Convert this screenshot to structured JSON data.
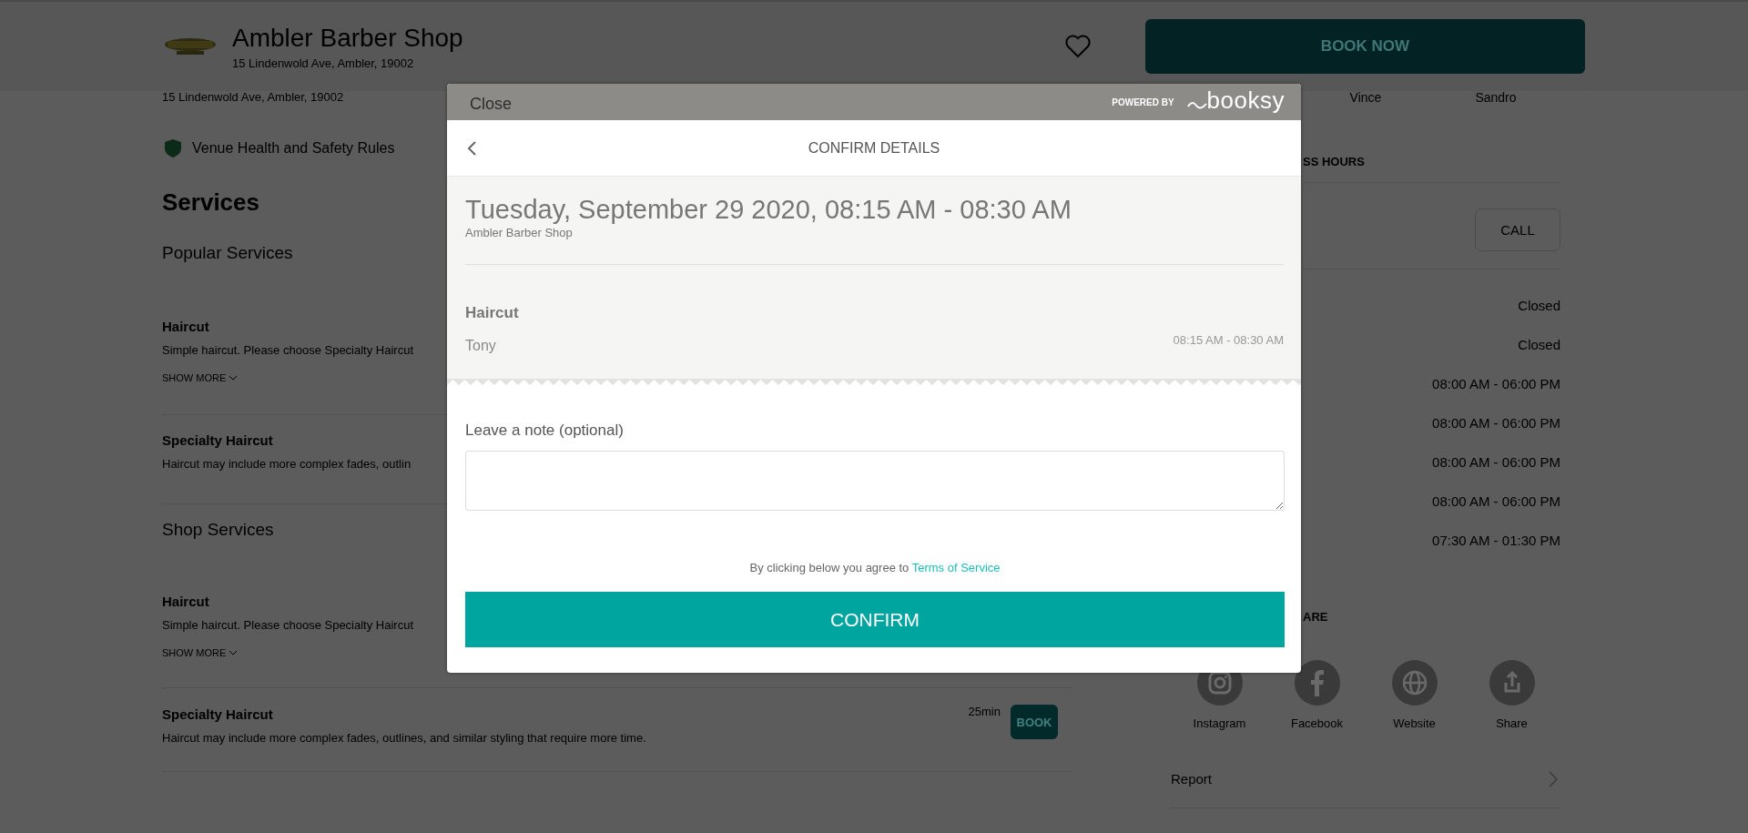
{
  "header": {
    "shop_name": "Ambler Barber Shop",
    "address": "15 Lindenwold Ave, Ambler, 19002",
    "favorited": false,
    "book_button": "BOOK NOW"
  },
  "details": {
    "address": "15 Lindenwold Ave, Ambler, 19002",
    "health_link": "Venue Health and Safety Rules"
  },
  "services": {
    "title": "Services",
    "groups": [
      {
        "title": "Popular Services",
        "items": [
          {
            "name": "Haircut",
            "description": "Simple haircut. Please choose Specialty Haircut",
            "show_more": "SHOW MORE"
          },
          {
            "name": "Specialty Haircut",
            "description": "Haircut may include more complex fades, outlin"
          }
        ]
      },
      {
        "title": "Shop Services",
        "items": [
          {
            "name": "Haircut",
            "description": "Simple haircut. Please choose Specialty Haircut",
            "show_more": "SHOW MORE"
          },
          {
            "name": "Specialty Haircut",
            "description": "Haircut may include more complex fades, outlines, and similar styling that require more time.",
            "duration": "25min",
            "book_button": "BOOK"
          }
        ]
      }
    ]
  },
  "sidebar": {
    "staff": [
      "Vince",
      "Sandro"
    ],
    "hours_heading": "SS HOURS",
    "call_button": "CALL",
    "hours": [
      "Closed",
      "Closed",
      "08:00 AM - 06:00 PM",
      "08:00 AM - 06:00 PM",
      "08:00 AM - 06:00 PM",
      "08:00 AM - 06:00 PM",
      "07:30 AM - 01:30 PM"
    ],
    "share_heading": "ARE",
    "social": [
      {
        "kind": "instagram",
        "label": "Instagram"
      },
      {
        "kind": "facebook",
        "label": "Facebook"
      },
      {
        "kind": "website",
        "label": "Website"
      },
      {
        "kind": "share",
        "label": "Share"
      }
    ],
    "report": "Report"
  },
  "modal": {
    "close": "Close",
    "powered_by": "POWERED BY",
    "brand": "booksy",
    "title": "CONFIRM DETAILS",
    "date": "Tuesday, September 29 2020, 08:15 AM - 08:30 AM",
    "shop": "Ambler Barber Shop",
    "service": {
      "name": "Haircut",
      "staff": "Tony",
      "time": "08:15 AM - 08:30 AM"
    },
    "note_label": "Leave a note (optional)",
    "agreement": "By clicking below you agree to",
    "terms_link": "Terms of Service",
    "confirm_button": "CONFIRM"
  }
}
